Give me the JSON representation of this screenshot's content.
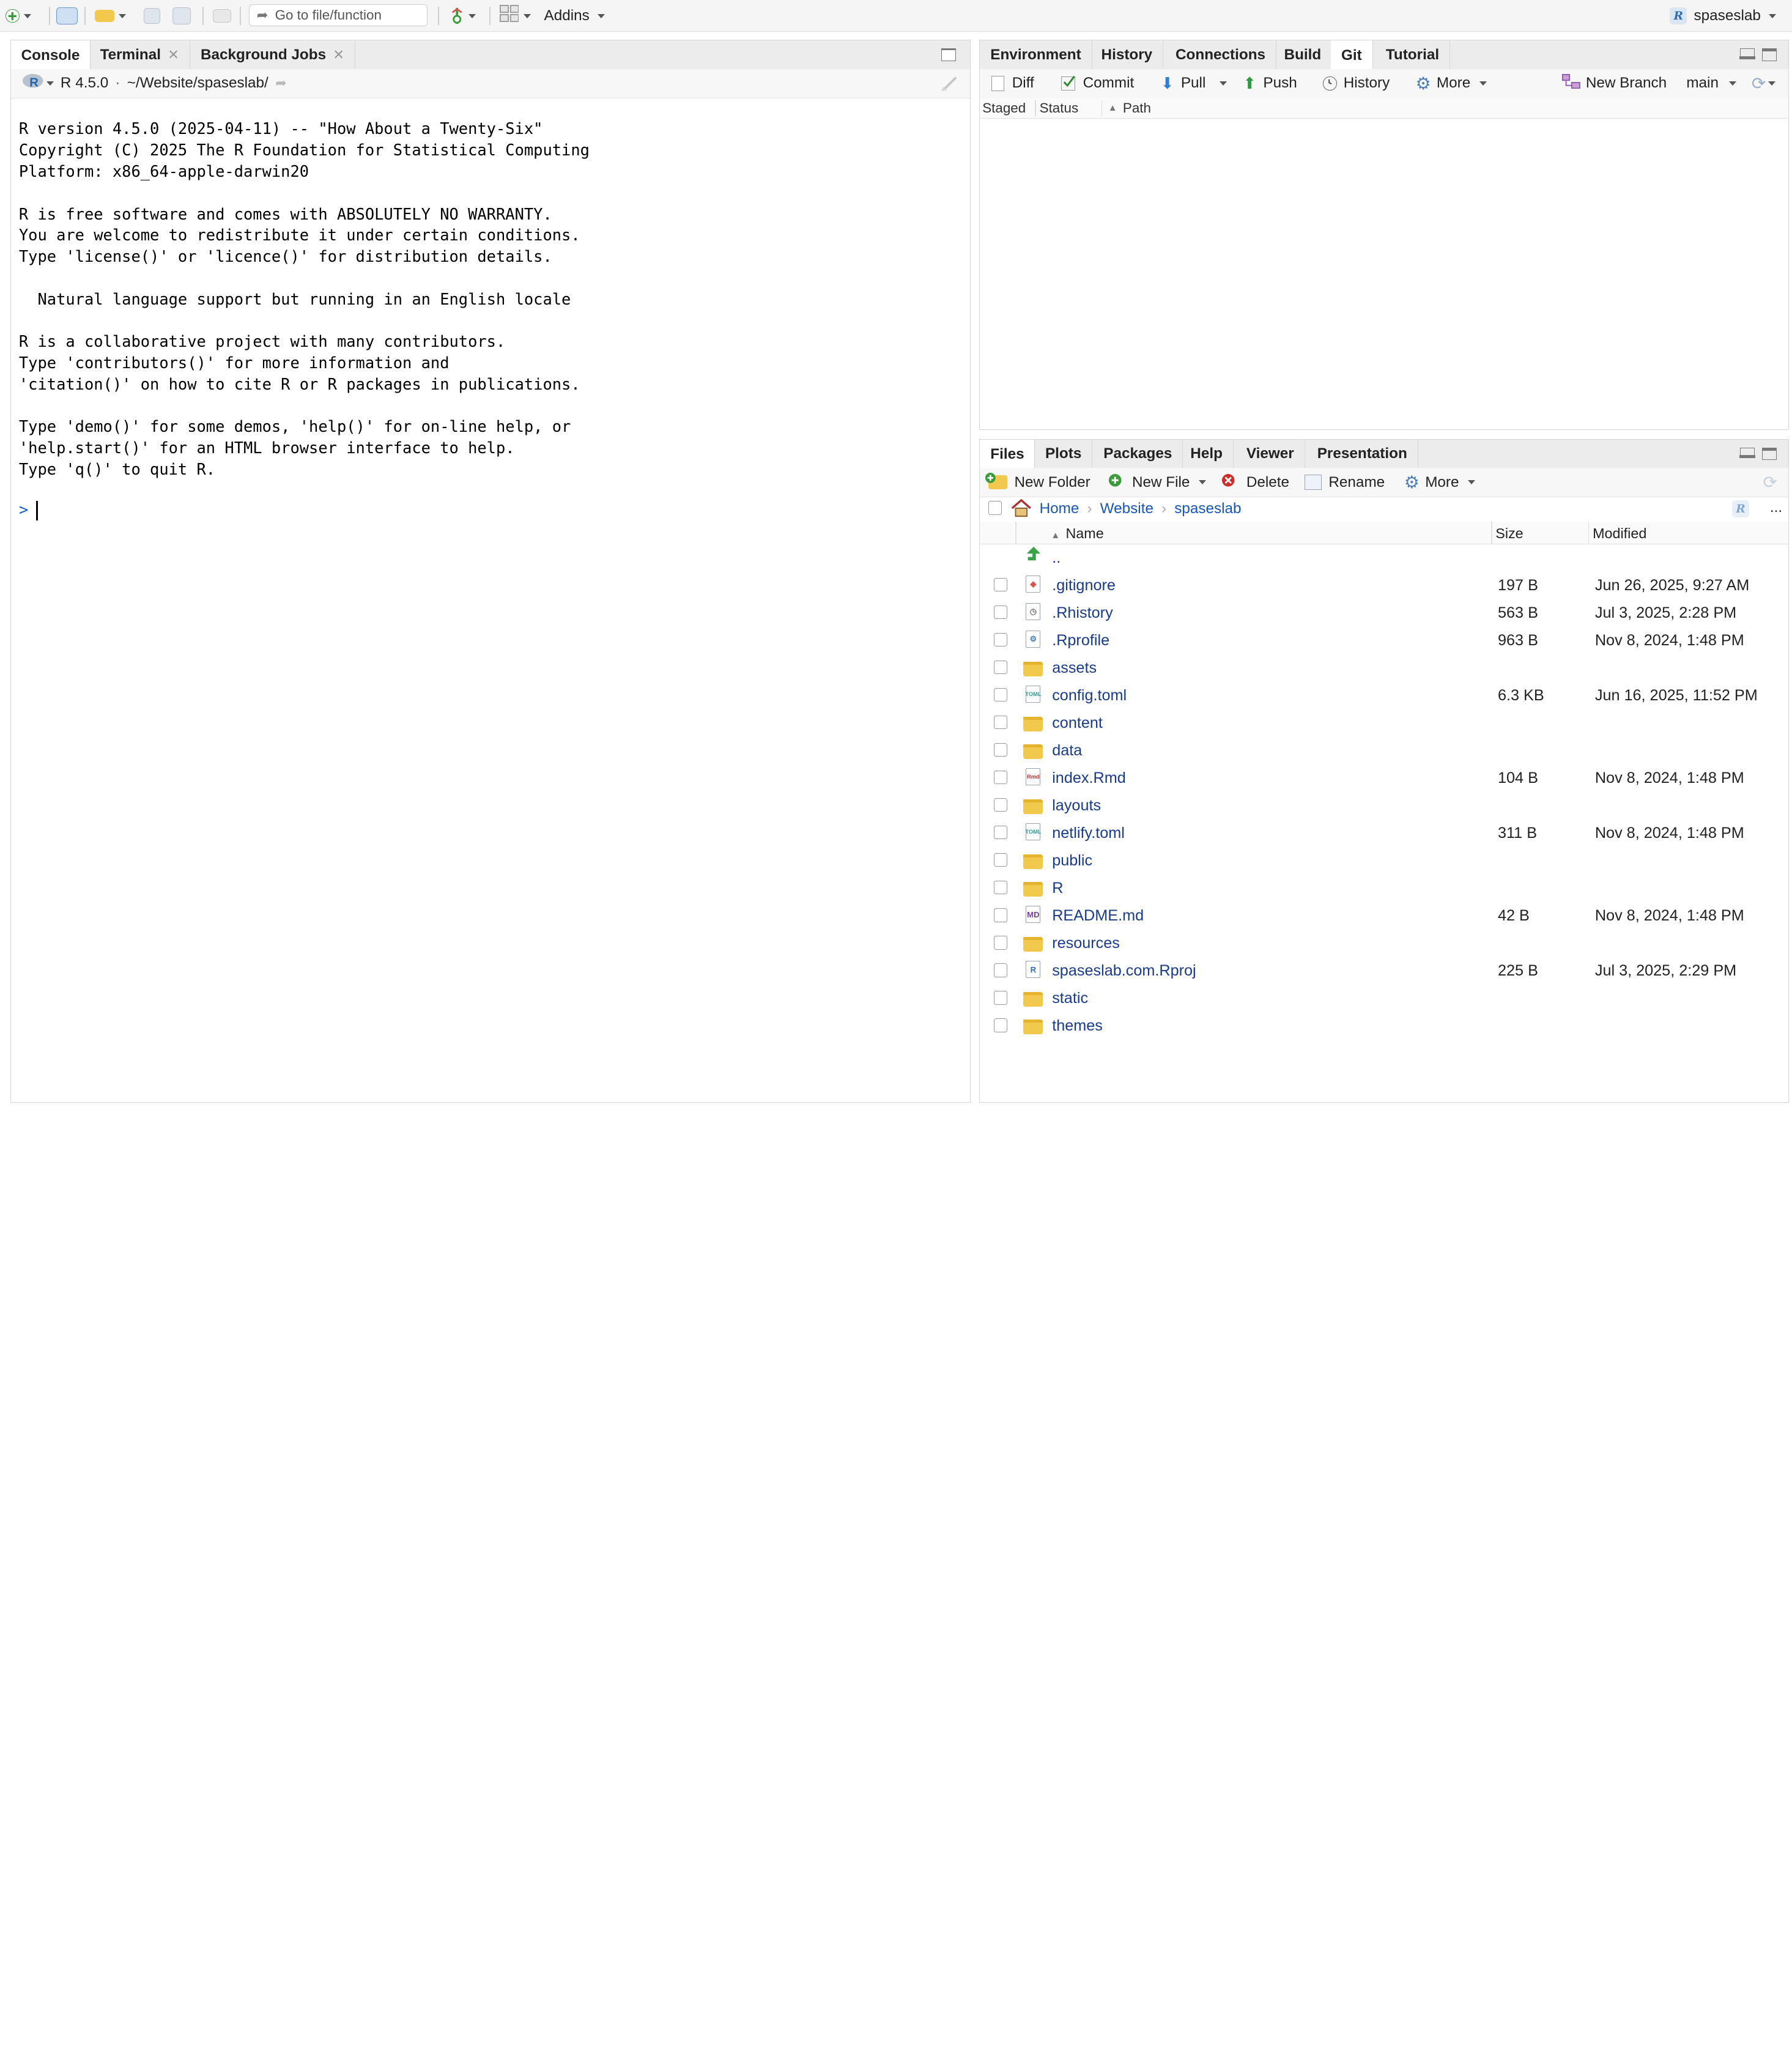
{
  "toolbar": {
    "goto_placeholder": "Go to file/function",
    "addins_label": "Addins",
    "project_name": "spaseslab"
  },
  "console_pane": {
    "tabs": [
      {
        "label": "Console"
      },
      {
        "label": "Terminal"
      },
      {
        "label": "Background Jobs"
      }
    ],
    "r_version": "R 4.5.0",
    "path_sep": "·",
    "working_dir": "~/Website/spaseslab/",
    "output": "R version 4.5.0 (2025-04-11) -- \"How About a Twenty-Six\"\nCopyright (C) 2025 The R Foundation for Statistical Computing\nPlatform: x86_64-apple-darwin20\n\nR is free software and comes with ABSOLUTELY NO WARRANTY.\nYou are welcome to redistribute it under certain conditions.\nType 'license()' or 'licence()' for distribution details.\n\n  Natural language support but running in an English locale\n\nR is a collaborative project with many contributors.\nType 'contributors()' for more information and\n'citation()' on how to cite R or R packages in publications.\n\nType 'demo()' for some demos, 'help()' for on-line help, or\n'help.start()' for an HTML browser interface to help.\nType 'q()' to quit R.",
    "prompt": ">"
  },
  "git_pane": {
    "tabs": [
      {
        "label": "Environment"
      },
      {
        "label": "History"
      },
      {
        "label": "Connections"
      },
      {
        "label": "Build"
      },
      {
        "label": "Git"
      },
      {
        "label": "Tutorial"
      }
    ],
    "buttons": {
      "diff": "Diff",
      "commit": "Commit",
      "pull": "Pull",
      "push": "Push",
      "history": "History",
      "more": "More",
      "new_branch": "New Branch",
      "branch": "main"
    },
    "columns": [
      "Staged",
      "Status",
      "Path"
    ]
  },
  "files_pane": {
    "tabs": [
      {
        "label": "Files"
      },
      {
        "label": "Plots"
      },
      {
        "label": "Packages"
      },
      {
        "label": "Help"
      },
      {
        "label": "Viewer"
      },
      {
        "label": "Presentation"
      }
    ],
    "buttons": {
      "new_folder": "New Folder",
      "new_file": "New File",
      "delete": "Delete",
      "rename": "Rename",
      "more": "More"
    },
    "breadcrumb": [
      "Home",
      "Website",
      "spaseslab"
    ],
    "breadcrumb_more": "...",
    "columns": {
      "name": "Name",
      "size": "Size",
      "modified": "Modified"
    },
    "parent_label": "..",
    "files": [
      {
        "name": ".gitignore",
        "size": "197 B",
        "modified": "Jun 26, 2025, 9:27 AM",
        "type": "gitignore"
      },
      {
        "name": ".Rhistory",
        "size": "563 B",
        "modified": "Jul 3, 2025, 2:28 PM",
        "type": "history"
      },
      {
        "name": ".Rprofile",
        "size": "963 B",
        "modified": "Nov 8, 2024, 1:48 PM",
        "type": "profile"
      },
      {
        "name": "assets",
        "size": "",
        "modified": "",
        "type": "folder"
      },
      {
        "name": "config.toml",
        "size": "6.3 KB",
        "modified": "Jun 16, 2025, 11:52 PM",
        "type": "toml"
      },
      {
        "name": "content",
        "size": "",
        "modified": "",
        "type": "folder"
      },
      {
        "name": "data",
        "size": "",
        "modified": "",
        "type": "folder"
      },
      {
        "name": "index.Rmd",
        "size": "104 B",
        "modified": "Nov 8, 2024, 1:48 PM",
        "type": "rmd"
      },
      {
        "name": "layouts",
        "size": "",
        "modified": "",
        "type": "folder"
      },
      {
        "name": "netlify.toml",
        "size": "311 B",
        "modified": "Nov 8, 2024, 1:48 PM",
        "type": "toml"
      },
      {
        "name": "public",
        "size": "",
        "modified": "",
        "type": "folder"
      },
      {
        "name": "R",
        "size": "",
        "modified": "",
        "type": "folder"
      },
      {
        "name": "README.md",
        "size": "42 B",
        "modified": "Nov 8, 2024, 1:48 PM",
        "type": "md"
      },
      {
        "name": "resources",
        "size": "",
        "modified": "",
        "type": "folder"
      },
      {
        "name": "spaseslab.com.Rproj",
        "size": "225 B",
        "modified": "Jul 3, 2025, 2:29 PM",
        "type": "rproj"
      },
      {
        "name": "static",
        "size": "",
        "modified": "",
        "type": "folder"
      },
      {
        "name": "themes",
        "size": "",
        "modified": "",
        "type": "folder"
      }
    ]
  }
}
